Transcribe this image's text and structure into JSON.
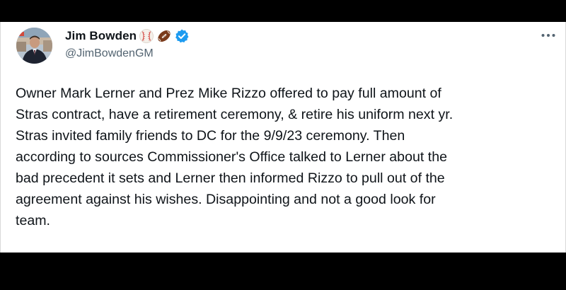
{
  "tweet": {
    "author": {
      "display_name": "Jim Bowden",
      "handle": "@JimBowdenGM",
      "badges": [
        "baseball-icon",
        "football-icon",
        "verified-badge-icon"
      ],
      "verified_color": "#1d9bf0"
    },
    "menu_icon": "more-options-icon",
    "text": "Owner Mark Lerner and Prez Mike Rizzo offered to pay full amount of\nStras contract, have a retirement ceremony, & retire his uniform next yr.\nStras invited family friends to DC for the 9/9/23 ceremony. Then\naccording to sources Commissioner's Office talked to Lerner about the\nbad precedent it sets and Lerner then informed Rizzo to pull out of the\nagreement against his wishes. Disappointing and not a good look for\nteam."
  },
  "colors": {
    "background": "#000000",
    "card": "#ffffff",
    "text_primary": "#0f1419",
    "text_secondary": "#536471"
  }
}
